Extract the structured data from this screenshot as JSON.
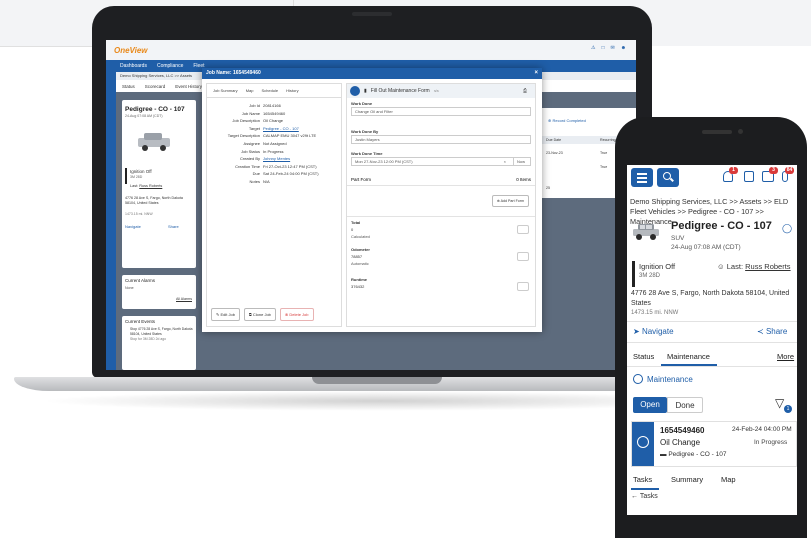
{
  "laptop_app": {
    "logo_main": "OneView",
    "nav": [
      "Dashboards",
      "Compliance",
      "Fleet"
    ],
    "crumb": "Demo Shipping Services, LLC  >>  Assets",
    "tabs": [
      "Status",
      "Scorecard",
      "Event History"
    ],
    "vehicle_name": "Pedigree - CO - 107",
    "vehicle_date": "24-Aug 07:08 AM (CDT)",
    "ignition": "Ignition Off",
    "ignition_sub": "3M 28D",
    "last_driver_label": "Last:",
    "last_driver": "Russ Roberts",
    "address": "4776 28 Ave S, Fargo, North Dakota 58104, United States",
    "address_dist": "1473.15 mi. NNW",
    "navigate": "Navigate",
    "share": "Share",
    "alarms_title": "Current Alarms",
    "alarms_value": "None",
    "alarms_link": "All Alarms",
    "events_title": "Current Events",
    "events_line1": "Stop 4776 28 Ave S, Fargo, North Dakota 58104, United States",
    "events_line2": "Stop for 3M 28D 2d ago",
    "right_headers": [
      "Due Date",
      "Recurring"
    ],
    "right_rows": [
      [
        "23-Nov-23",
        "True"
      ],
      [
        "",
        "True"
      ]
    ],
    "record_completed": "Record Completed",
    "pager": "25"
  },
  "modal": {
    "title": "Job Name: 1654549460",
    "tabs": [
      "Job Summary",
      "Map",
      "Schedule",
      "History"
    ],
    "fields": [
      {
        "k": "Job Id",
        "v": "20814166"
      },
      {
        "k": "Job Name",
        "v": "1654549460"
      },
      {
        "k": "Job Description",
        "v": "Oil Change"
      },
      {
        "k": "Target",
        "v": "Pedigree - CO - 107"
      },
      {
        "k": "Target Description",
        "v": "CALMAP EMU 3047 v29t LTE"
      },
      {
        "k": "Assignee",
        "v": "Not Assigned"
      },
      {
        "k": "Job Status",
        "v": "In Progress"
      },
      {
        "k": "Created By",
        "v": "Johnny Mentes"
      },
      {
        "k": "Creation Time",
        "v": "Fri 27-Oct-23 12:47 PM (CST)"
      },
      {
        "k": "Due",
        "v": "Sat 24-Feb-24 04:00 PM (CST)"
      },
      {
        "k": "Notes",
        "v": "N/A"
      }
    ],
    "edit_job": "Edit Job",
    "clone_job": "Clone Job",
    "delete_job": "Delete Job",
    "form_title": "Fill Out Maintenance Form",
    "form_sub": "n/a",
    "work_done_label": "Work Done",
    "work_done_value": "Change Oil and Filter",
    "work_done_by_label": "Work Done By",
    "work_done_by_value": "Justin Mayers",
    "work_done_time_label": "Work Done Time",
    "work_done_time_value": "Mon 27-Nov-23 12:00 PM (CST)",
    "now_button": "Now",
    "part_form": "Part Form",
    "part_items": "0 Items",
    "add_part": "Add Part Form",
    "total_label": "Total",
    "total_value": "0",
    "total_sub": "Calculated",
    "odometer_label": "Odometer",
    "odometer_value": "78857",
    "odometer_sub": "Automatic",
    "runtime_label": "Runtime",
    "runtime_value": "376432"
  },
  "phone": {
    "badges": [
      "1",
      "3",
      "84"
    ],
    "crumb": "Demo Shipping Services, LLC  >>  Assets  >>  ELD Fleet Vehicles  >>  Pedigree - CO - 107  >>  Maintenance",
    "title": "Pedigree - CO - 107",
    "subtype": "SUV",
    "date": "24-Aug 07:08 AM (CDT)",
    "ignition": "Ignition Off",
    "ignition_sub": "3M 28D",
    "last_label": "Last:",
    "last_driver": "Russ Roberts",
    "address": "4776 28 Ave S, Fargo, North Dakota 58104, United States",
    "distance": "1473.15 mi. NNW",
    "navigate": "Navigate",
    "share": "Share",
    "tabs": [
      "Status",
      "Maintenance"
    ],
    "more": "More",
    "section": "Maintenance",
    "open": "Open",
    "done": "Done",
    "filter_count": "1",
    "job_id": "1654549460",
    "job_date": "24-Feb-24 04:00 PM",
    "job_name": "Oil Change",
    "job_status": "In Progress",
    "job_asset": "Pedigree - CO - 107",
    "bottom_tabs": [
      "Tasks",
      "Summary",
      "Map"
    ],
    "back": "Tasks"
  }
}
